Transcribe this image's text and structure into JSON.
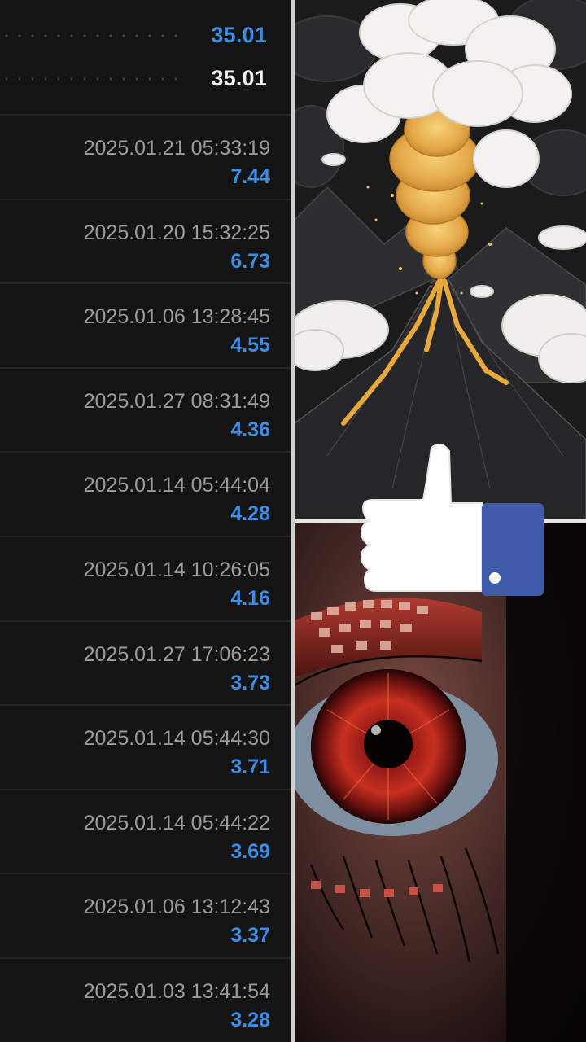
{
  "summary": {
    "value_top": "35.01",
    "value_bottom": "35.01"
  },
  "trades": [
    {
      "time": "2025.01.21 05:33:19",
      "profit": "7.44"
    },
    {
      "time": "2025.01.20 15:32:25",
      "profit": "6.73"
    },
    {
      "time": "2025.01.06 13:28:45",
      "profit": "4.55"
    },
    {
      "time": "2025.01.27 08:31:49",
      "profit": "4.36"
    },
    {
      "time": "2025.01.14 05:44:04",
      "profit": "4.28"
    },
    {
      "time": "2025.01.14 10:26:05",
      "profit": "4.16"
    },
    {
      "time": "2025.01.27 17:06:23",
      "profit": "3.73"
    },
    {
      "time": "2025.01.14 05:44:30",
      "profit": "3.71"
    },
    {
      "time": "2025.01.14 05:44:22",
      "profit": "3.69"
    },
    {
      "time": "2025.01.06 13:12:43",
      "profit": "3.37"
    },
    {
      "time": "2025.01.03 13:41:54",
      "profit": "3.28"
    }
  ],
  "colors": {
    "profit_blue": "#3b8ee6",
    "timestamp_gray": "#9b9b9b",
    "panel_bg": "#141414",
    "like_blue": "#3f5ba9"
  },
  "images": {
    "top_right": "volcano-illustration",
    "bottom_right": "eye-closeup",
    "overlay": "thumbs-up-icon"
  }
}
